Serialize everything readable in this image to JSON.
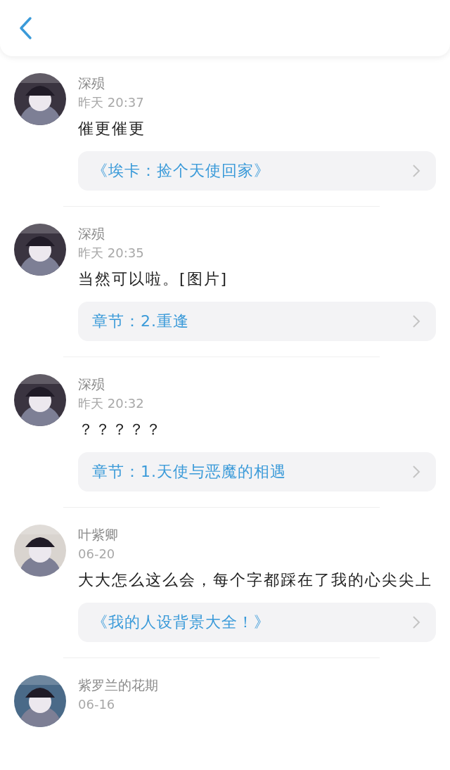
{
  "comments": [
    {
      "name": "深殒",
      "time": "昨天 20:37",
      "text": "催更催更",
      "link": "《埃卡：捡个天使回家》"
    },
    {
      "name": "深殒",
      "time": "昨天 20:35",
      "text": "当然可以啦。[图片]",
      "link": "章节：2.重逢"
    },
    {
      "name": "深殒",
      "time": "昨天 20:32",
      "text": "？？？？？",
      "link": "章节：1.天使与恶魔的相遇"
    },
    {
      "name": "叶紫卿",
      "time": "06-20",
      "text": "大大怎么这么会，每个字都踩在了我的心尖尖上",
      "link": "《我的人设背景大全！》"
    },
    {
      "name": "紫罗兰的花期",
      "time": "06-16"
    }
  ]
}
